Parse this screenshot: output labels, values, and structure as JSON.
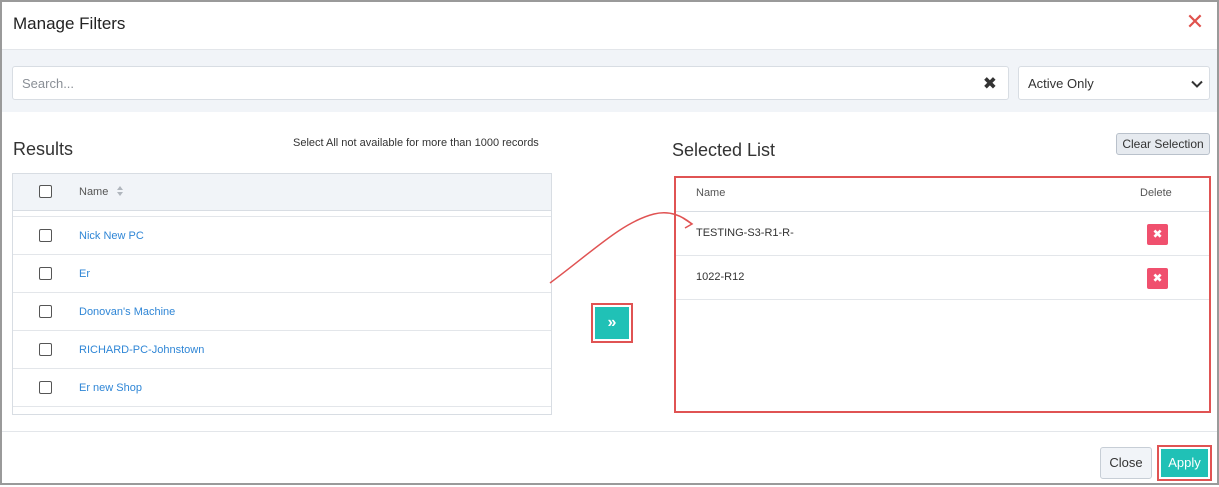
{
  "dialog": {
    "title": "Manage Filters",
    "close_icon": "close-icon"
  },
  "filter": {
    "search_placeholder": "Search...",
    "search_value": "",
    "clear_glyph": "✖",
    "status_selected": "Active Only"
  },
  "results": {
    "title": "Results",
    "note": "Select All not available for more than 1000 records",
    "header_name": "Name",
    "rows": [
      {
        "name": "Nick New PC"
      },
      {
        "name": "Er"
      },
      {
        "name": "Donovan's Machine"
      },
      {
        "name": "RICHARD-PC-Johnstown"
      },
      {
        "name": "Er new Shop"
      }
    ]
  },
  "transfer": {
    "glyph": "»"
  },
  "selected": {
    "title": "Selected List",
    "clear_label": "Clear Selection",
    "header_name": "Name",
    "header_delete": "Delete",
    "delete_glyph": "✖",
    "rows": [
      {
        "name": "TESTING-S3-R1-R-"
      },
      {
        "name": "1022-R12"
      }
    ]
  },
  "footer": {
    "close_label": "Close",
    "apply_label": "Apply"
  },
  "colors": {
    "accent": "#20c1b6",
    "link": "#2f86d6",
    "delete": "#f0506e",
    "highlight": "#e05353"
  }
}
